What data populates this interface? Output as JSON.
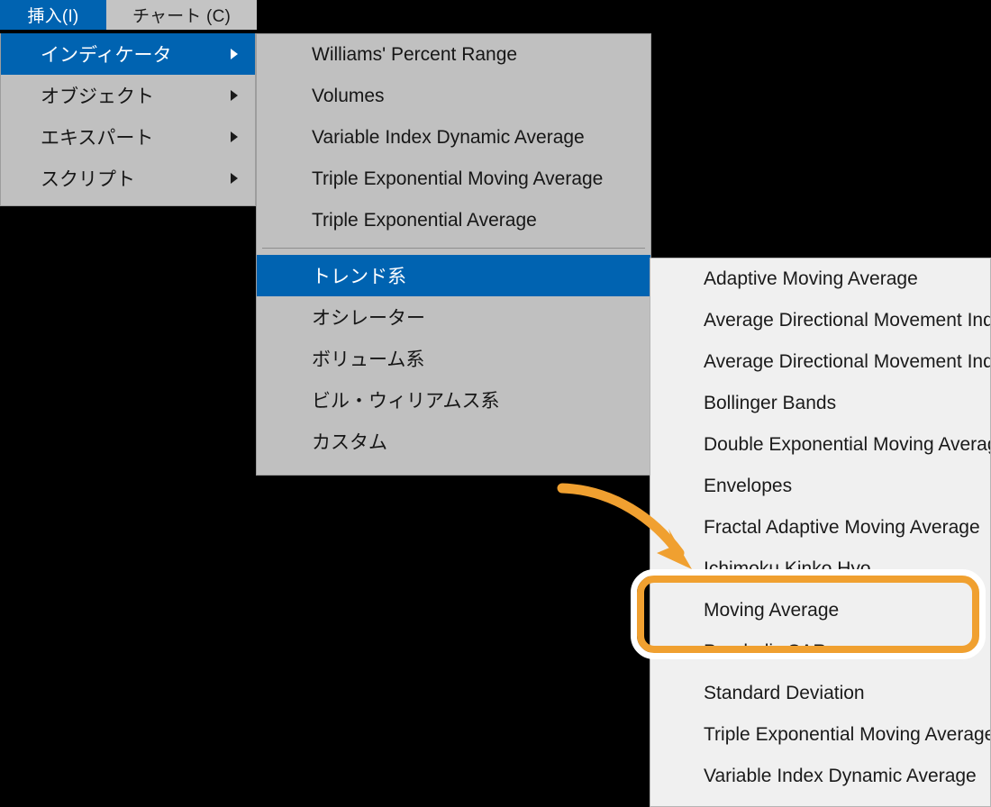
{
  "app": {
    "context": "MetaTrader insert indicator menu (Japanese UI)"
  },
  "colors": {
    "menu_highlight_blue": "#0063B1",
    "panel_gray": "#C0C0C0",
    "panel_light": "#F0F0F0",
    "annotation_orange": "#F0A030",
    "annotation_outline_white": "#FFFFFF",
    "text_dark": "#1A1A1A",
    "background_black": "#000000"
  },
  "menubar": {
    "items": [
      {
        "label": "挿入(I)",
        "state": "active"
      },
      {
        "label": "チャート (C)",
        "state": "normal"
      }
    ]
  },
  "panel1": {
    "name": "insert-menu",
    "items": [
      {
        "label": "インディケータ",
        "has_submenu": true,
        "selected": true
      },
      {
        "label": "オブジェクト",
        "has_submenu": true,
        "selected": false
      },
      {
        "label": "エキスパート",
        "has_submenu": true,
        "selected": false
      },
      {
        "label": "スクリプト",
        "has_submenu": true,
        "selected": false
      }
    ]
  },
  "panel2": {
    "name": "indicators-submenu",
    "top_items": [
      {
        "label": "Williams' Percent Range"
      },
      {
        "label": "Volumes"
      },
      {
        "label": "Variable Index Dynamic Average"
      },
      {
        "label": "Triple Exponential Moving Average"
      },
      {
        "label": "Triple Exponential Average"
      }
    ],
    "category_items": [
      {
        "label": "トレンド系",
        "selected": true
      },
      {
        "label": "オシレーター",
        "selected": false
      },
      {
        "label": "ボリューム系",
        "selected": false
      },
      {
        "label": "ビル・ウィリアムス系",
        "selected": false
      },
      {
        "label": "カスタム",
        "selected": false
      }
    ]
  },
  "panel3": {
    "name": "trend-indicators-submenu",
    "items": [
      {
        "label": "Adaptive Moving Average",
        "highlighted": false
      },
      {
        "label": "Average Directional Movement Index",
        "highlighted": false
      },
      {
        "label": "Average Directional Movement Index Wilder",
        "highlighted": false
      },
      {
        "label": "Bollinger Bands",
        "highlighted": false
      },
      {
        "label": "Double Exponential Moving Average",
        "highlighted": false
      },
      {
        "label": "Envelopes",
        "highlighted": false
      },
      {
        "label": "Fractal Adaptive Moving Average",
        "highlighted": false
      },
      {
        "label": "Ichimoku Kinko Hyo",
        "highlighted": false
      },
      {
        "label": "Moving Average",
        "highlighted": true
      },
      {
        "label": "Parabolic SAR",
        "highlighted": false
      },
      {
        "label": "Standard Deviation",
        "highlighted": false
      },
      {
        "label": "Triple Exponential Moving Average",
        "highlighted": false
      },
      {
        "label": "Variable Index Dynamic Average",
        "highlighted": false
      }
    ]
  },
  "annotations": {
    "callout_target": "Moving Average",
    "arrow": "curved-arrow-pointing-to-moving-average"
  }
}
